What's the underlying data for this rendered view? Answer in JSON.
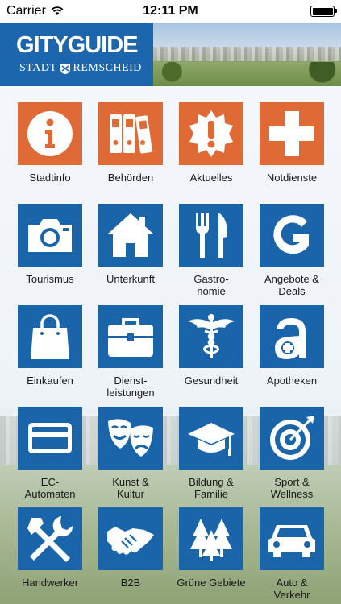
{
  "status_bar": {
    "carrier": "Carrier",
    "time": "12:11 PM"
  },
  "header": {
    "logo_main": "GITYGUIDE",
    "logo_sub_left": "STADT",
    "logo_sub_right": "REMSCHEID"
  },
  "colors": {
    "orange": "#e06a35",
    "blue": "#1a64aa",
    "header_blue": "#1b66ac"
  },
  "tiles": [
    {
      "label": "Stadtinfo",
      "icon": "info-icon"
    },
    {
      "label": "Behörden",
      "icon": "binders-icon"
    },
    {
      "label": "Aktuelles",
      "icon": "alert-badge-icon"
    },
    {
      "label": "Notdienste",
      "icon": "cross-icon"
    },
    {
      "label": "Tourismus",
      "icon": "camera-icon"
    },
    {
      "label": "Unterkunft",
      "icon": "house-icon"
    },
    {
      "label": "Gastro-\nnomie",
      "icon": "cutlery-icon"
    },
    {
      "label": "Angebote &\nDeals",
      "icon": "g-logo-icon"
    },
    {
      "label": "Einkaufen",
      "icon": "shopping-bag-icon"
    },
    {
      "label": "Dienst-\nleistungen",
      "icon": "briefcase-icon"
    },
    {
      "label": "Gesundheit",
      "icon": "caduceus-icon"
    },
    {
      "label": "Apotheken",
      "icon": "pharmacy-icon"
    },
    {
      "label": "EC-\nAutomaten",
      "icon": "card-icon"
    },
    {
      "label": "Kunst &\nKultur",
      "icon": "theater-masks-icon"
    },
    {
      "label": "Bildung &\nFamilie",
      "icon": "graduation-cap-icon"
    },
    {
      "label": "Sport &\nWellness",
      "icon": "target-icon"
    },
    {
      "label": "Handwerker",
      "icon": "tools-icon"
    },
    {
      "label": "B2B",
      "icon": "handshake-icon"
    },
    {
      "label": "Grüne Gebiete",
      "icon": "trees-icon"
    },
    {
      "label": "Auto &\nVerkehr",
      "icon": "car-icon"
    }
  ]
}
